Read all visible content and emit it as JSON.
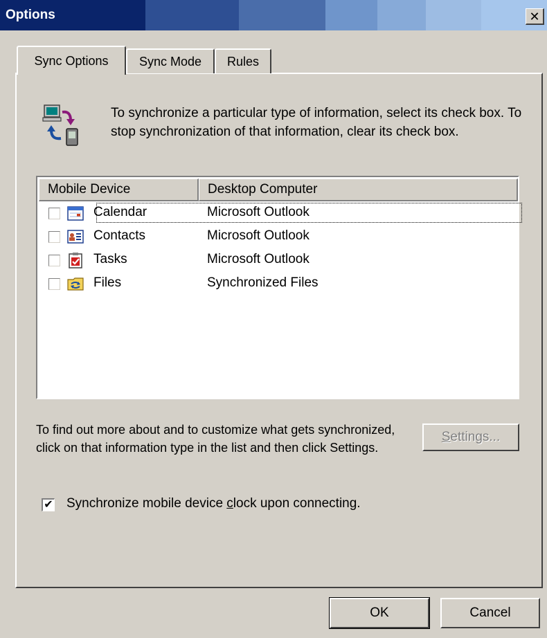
{
  "window": {
    "title": "Options",
    "close_glyph": "✕"
  },
  "tabs": [
    {
      "label": "Sync Options",
      "active": true
    },
    {
      "label": "Sync Mode",
      "active": false
    },
    {
      "label": "Rules",
      "active": false
    }
  ],
  "intro": {
    "icon": "sync-devices-icon",
    "text": "To synchronize a particular type of information, select its check box. To stop synchronization of that information, clear its check box."
  },
  "list": {
    "columns": [
      "Mobile Device",
      "Desktop Computer"
    ],
    "rows": [
      {
        "checked": false,
        "icon": "calendar-icon",
        "name": "Calendar",
        "desktop": "Microsoft Outlook"
      },
      {
        "checked": false,
        "icon": "contacts-icon",
        "name": "Contacts",
        "desktop": "Microsoft Outlook"
      },
      {
        "checked": false,
        "icon": "tasks-icon",
        "name": "Tasks",
        "desktop": "Microsoft Outlook"
      },
      {
        "checked": false,
        "icon": "files-icon",
        "name": "Files",
        "desktop": "Synchronized Files"
      }
    ]
  },
  "help_text": "To find out more about and to customize what gets synchronized, click on that information type in the list and then click Settings.",
  "settings_button": {
    "label_accel": "S",
    "label_rest": "ettings...",
    "enabled": false
  },
  "clock_option": {
    "checked": true,
    "label_before": "Synchronize mobile device ",
    "label_accel": "c",
    "label_after": "lock upon connecting."
  },
  "footer": {
    "ok_label": "OK",
    "cancel_label": "Cancel"
  }
}
